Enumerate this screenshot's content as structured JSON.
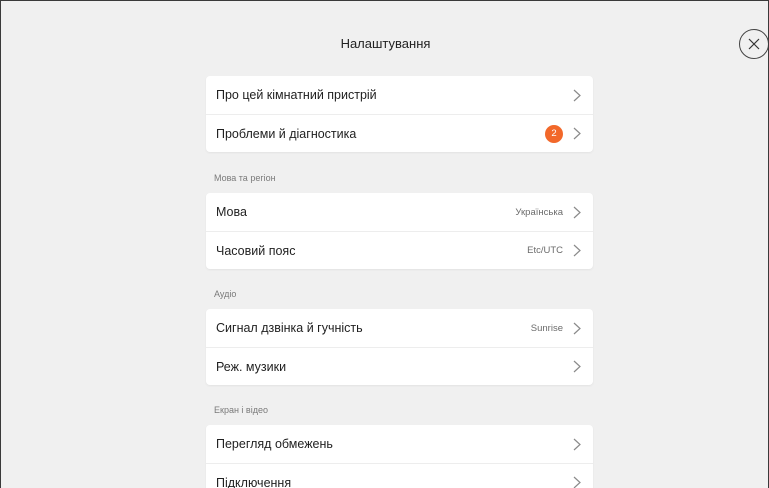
{
  "header": {
    "title": "Налаштування",
    "close_icon": "close-icon"
  },
  "sections": [
    {
      "label": "",
      "items": [
        {
          "label": "Про цей кімнатний пристрій",
          "value": "",
          "badge": ""
        },
        {
          "label": "Проблеми й діагностика",
          "value": "",
          "badge": "2"
        }
      ]
    },
    {
      "label": "Мова та регіон",
      "items": [
        {
          "label": "Мова",
          "value": "Українська",
          "badge": ""
        },
        {
          "label": "Часовий пояс",
          "value": "Etc/UTC",
          "badge": ""
        }
      ]
    },
    {
      "label": "Аудіо",
      "items": [
        {
          "label": "Сигнал дзвінка й гучність",
          "value": "Sunrise",
          "badge": ""
        },
        {
          "label": "Реж. музики",
          "value": "",
          "badge": ""
        }
      ]
    },
    {
      "label": "Екран і відео",
      "items": [
        {
          "label": "Перегляд обмежень",
          "value": "",
          "badge": ""
        },
        {
          "label": "Підключення",
          "value": "",
          "badge": ""
        }
      ]
    }
  ],
  "colors": {
    "background": "#f0f0f0",
    "card": "#ffffff",
    "badge": "#f2682a"
  }
}
